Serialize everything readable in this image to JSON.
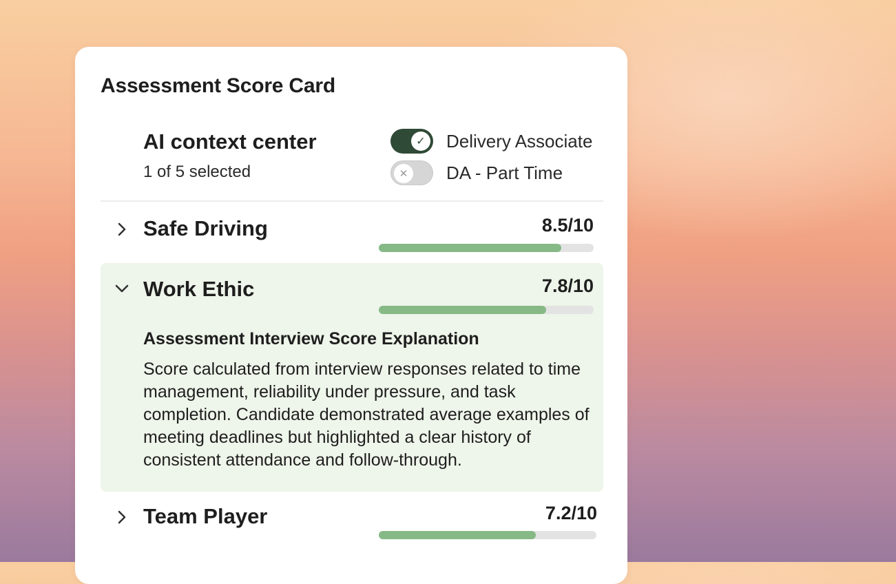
{
  "card": {
    "title": "Assessment Score Card"
  },
  "context": {
    "title": "AI context center",
    "selected_text": "1 of 5 selected",
    "toggles": [
      {
        "label": "Delivery Associate",
        "on": true,
        "icon": "check-icon",
        "glyph": "✓"
      },
      {
        "label": "DA - Part Time",
        "on": false,
        "icon": "x-icon",
        "glyph": "✕"
      }
    ]
  },
  "categories": [
    {
      "name": "Safe Driving",
      "score": "8.5/10",
      "value": 8.5,
      "max": 10,
      "expanded": false
    },
    {
      "name": "Work Ethic",
      "score": "7.8/10",
      "value": 7.8,
      "max": 10,
      "expanded": true,
      "explanation_title": "Assessment Interview Score Explanation",
      "explanation": "Score calculated from interview responses related to time management, reliability under pressure, and task completion. Candidate demonstrated average examples of meeting deadlines but highlighted a clear history of consistent attendance and follow-through."
    },
    {
      "name": "Team Player",
      "score": "7.2/10",
      "value": 7.2,
      "max": 10,
      "expanded": false
    }
  ],
  "colors": {
    "toggle_on": "#2f4a36",
    "bar_fill": "#86b986",
    "bar_track": "#e3e3e3",
    "expanded_bg": "#eef5ea"
  }
}
